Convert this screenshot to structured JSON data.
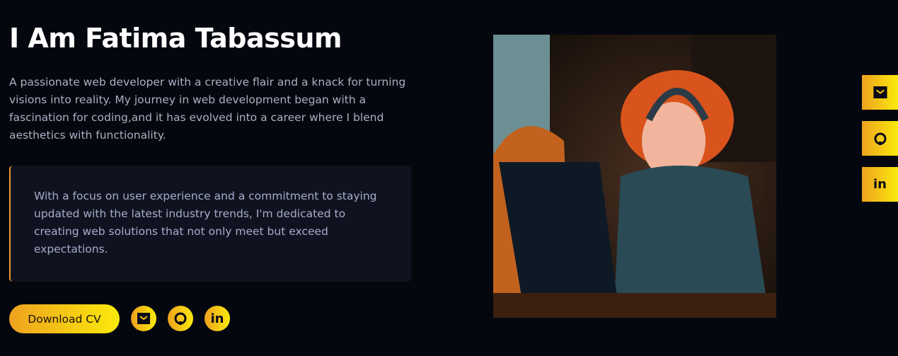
{
  "hero": {
    "title": "I Am Fatima Tabassum",
    "intro": "A passionate web developer with a creative flair and a knack for turning visions into reality. My journey in web development began with a fascination for coding,and it has evolved into a career where I blend aesthetics with functionality.",
    "quote": "With a focus on user experience and a commitment to staying updated with the latest industry trends, I'm dedicated to creating web solutions that not only meet but exceed expectations.",
    "download_label": "Download CV",
    "social": [
      {
        "icon": "mail-icon"
      },
      {
        "icon": "github-icon"
      },
      {
        "icon": "linkedin-icon",
        "text": "in"
      }
    ]
  },
  "side_social": [
    {
      "icon": "mail-icon"
    },
    {
      "icon": "github-icon"
    },
    {
      "icon": "linkedin-icon",
      "text": "in"
    }
  ],
  "colors": {
    "background": "#05070f",
    "accent_start": "#eea21f",
    "accent_end": "#fbea0b",
    "card": "#10131f"
  }
}
